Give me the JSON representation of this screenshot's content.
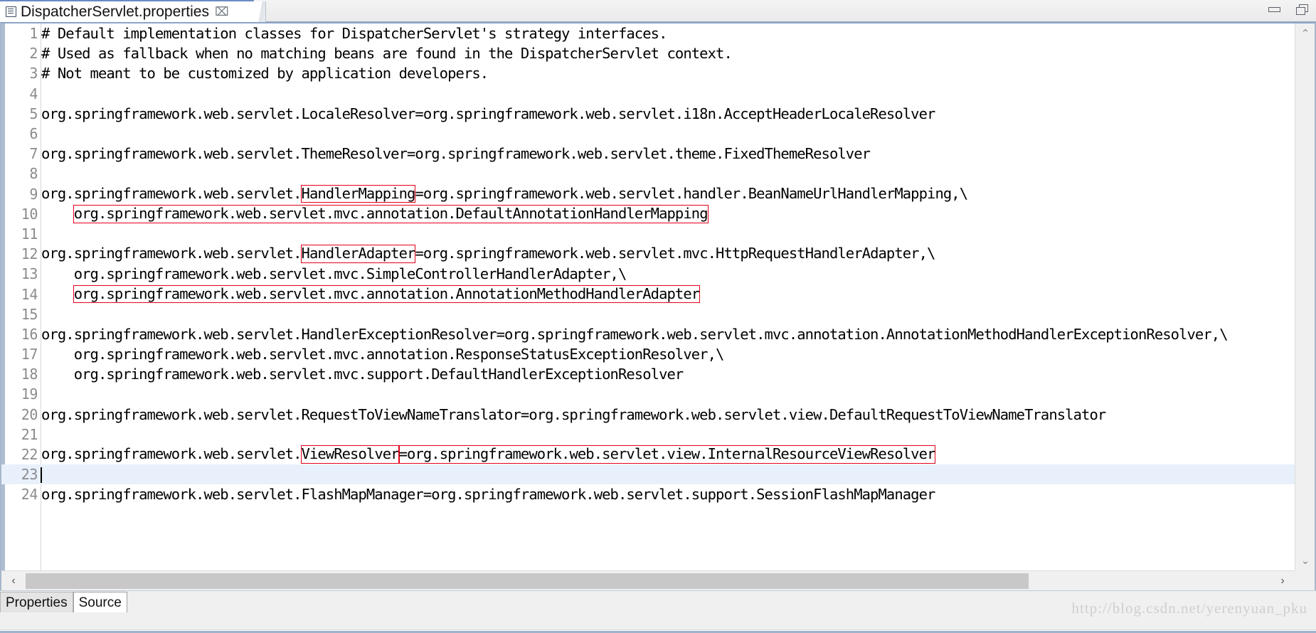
{
  "window": {
    "tab_title": "DispatcherServlet.properties",
    "tab_icon": "properties-file-icon",
    "close_label": "⌧",
    "minimize_label": "minimize",
    "maximize_label": "maximize"
  },
  "editor": {
    "lines": [
      {
        "num": "1",
        "indent": 0,
        "segments": [
          {
            "t": "# Default implementation classes for DispatcherServlet's strategy interfaces."
          }
        ]
      },
      {
        "num": "2",
        "indent": 0,
        "segments": [
          {
            "t": "# Used as fallback when no matching beans are found in the DispatcherServlet context."
          }
        ]
      },
      {
        "num": "3",
        "indent": 0,
        "segments": [
          {
            "t": "# Not meant to be customized by application developers."
          }
        ]
      },
      {
        "num": "4",
        "indent": 0,
        "segments": [
          {
            "t": ""
          }
        ]
      },
      {
        "num": "5",
        "indent": 0,
        "segments": [
          {
            "t": "org.springframework.web.servlet.LocaleResolver=org.springframework.web.servlet.i18n.AcceptHeaderLocaleResolver"
          }
        ]
      },
      {
        "num": "6",
        "indent": 0,
        "segments": [
          {
            "t": ""
          }
        ]
      },
      {
        "num": "7",
        "indent": 0,
        "segments": [
          {
            "t": "org.springframework.web.servlet.ThemeResolver=org.springframework.web.servlet.theme.FixedThemeResolver"
          }
        ]
      },
      {
        "num": "8",
        "indent": 0,
        "segments": [
          {
            "t": ""
          }
        ]
      },
      {
        "num": "9",
        "indent": 0,
        "segments": [
          {
            "t": "org.springframework.web.servlet."
          },
          {
            "t": "HandlerMapping",
            "box": true
          },
          {
            "t": "=org.springframework.web.servlet.handler.BeanNameUrlHandlerMapping,\\"
          }
        ]
      },
      {
        "num": "10",
        "indent": 0,
        "segments": [
          {
            "t": "    "
          },
          {
            "t": "org.springframework.web.servlet.mvc.annotation.DefaultAnnotationHandlerMapping",
            "box": true
          }
        ]
      },
      {
        "num": "11",
        "indent": 0,
        "segments": [
          {
            "t": ""
          }
        ]
      },
      {
        "num": "12",
        "indent": 0,
        "segments": [
          {
            "t": "org.springframework.web.servlet."
          },
          {
            "t": "HandlerAdapter",
            "box": true
          },
          {
            "t": "=org.springframework.web.servlet.mvc.HttpRequestHandlerAdapter,\\"
          }
        ]
      },
      {
        "num": "13",
        "indent": 0,
        "segments": [
          {
            "t": "    org.springframework.web.servlet.mvc.SimpleControllerHandlerAdapter,\\"
          }
        ]
      },
      {
        "num": "14",
        "indent": 0,
        "segments": [
          {
            "t": "    "
          },
          {
            "t": "org.springframework.web.servlet.mvc.annotation.AnnotationMethodHandlerAdapter",
            "box": true
          }
        ]
      },
      {
        "num": "15",
        "indent": 0,
        "segments": [
          {
            "t": ""
          }
        ]
      },
      {
        "num": "16",
        "indent": 0,
        "segments": [
          {
            "t": "org.springframework.web.servlet.HandlerExceptionResolver=org.springframework.web.servlet.mvc.annotation.AnnotationMethodHandlerExceptionResolver,\\"
          }
        ]
      },
      {
        "num": "17",
        "indent": 0,
        "segments": [
          {
            "t": "    org.springframework.web.servlet.mvc.annotation.ResponseStatusExceptionResolver,\\"
          }
        ]
      },
      {
        "num": "18",
        "indent": 0,
        "segments": [
          {
            "t": "    org.springframework.web.servlet.mvc.support.DefaultHandlerExceptionResolver"
          }
        ]
      },
      {
        "num": "19",
        "indent": 0,
        "segments": [
          {
            "t": ""
          }
        ]
      },
      {
        "num": "20",
        "indent": 0,
        "segments": [
          {
            "t": "org.springframework.web.servlet.RequestToViewNameTranslator=org.springframework.web.servlet.view.DefaultRequestToViewNameTranslator"
          }
        ]
      },
      {
        "num": "21",
        "indent": 0,
        "segments": [
          {
            "t": ""
          }
        ]
      },
      {
        "num": "22",
        "indent": 0,
        "segments": [
          {
            "t": "org.springframework.web.servlet."
          },
          {
            "t": "ViewResolver",
            "box": true
          },
          {
            "t": "=org.springframework.web.servlet.view.InternalResourceViewResolver",
            "box": true
          }
        ]
      },
      {
        "num": "23",
        "indent": 0,
        "current": true,
        "caret": true,
        "segments": [
          {
            "t": ""
          }
        ]
      },
      {
        "num": "24",
        "indent": 0,
        "segments": [
          {
            "t": "org.springframework.web.servlet.FlashMapManager=org.springframework.web.servlet.support.SessionFlashMapManager"
          }
        ]
      }
    ],
    "highlight_color": "#e8f1fb",
    "annotation_color": "#e4001b",
    "line_number_color": "#8b8b8b"
  },
  "scrollbars": {
    "up_arrow": "⌃",
    "down_arrow": "⌄",
    "left_arrow": "‹",
    "right_arrow": "›"
  },
  "bottom": {
    "tabs": [
      {
        "label": "Properties",
        "active": false
      },
      {
        "label": "Source",
        "active": true
      }
    ],
    "watermark": "http://blog.csdn.net/yerenyuan_pku"
  }
}
